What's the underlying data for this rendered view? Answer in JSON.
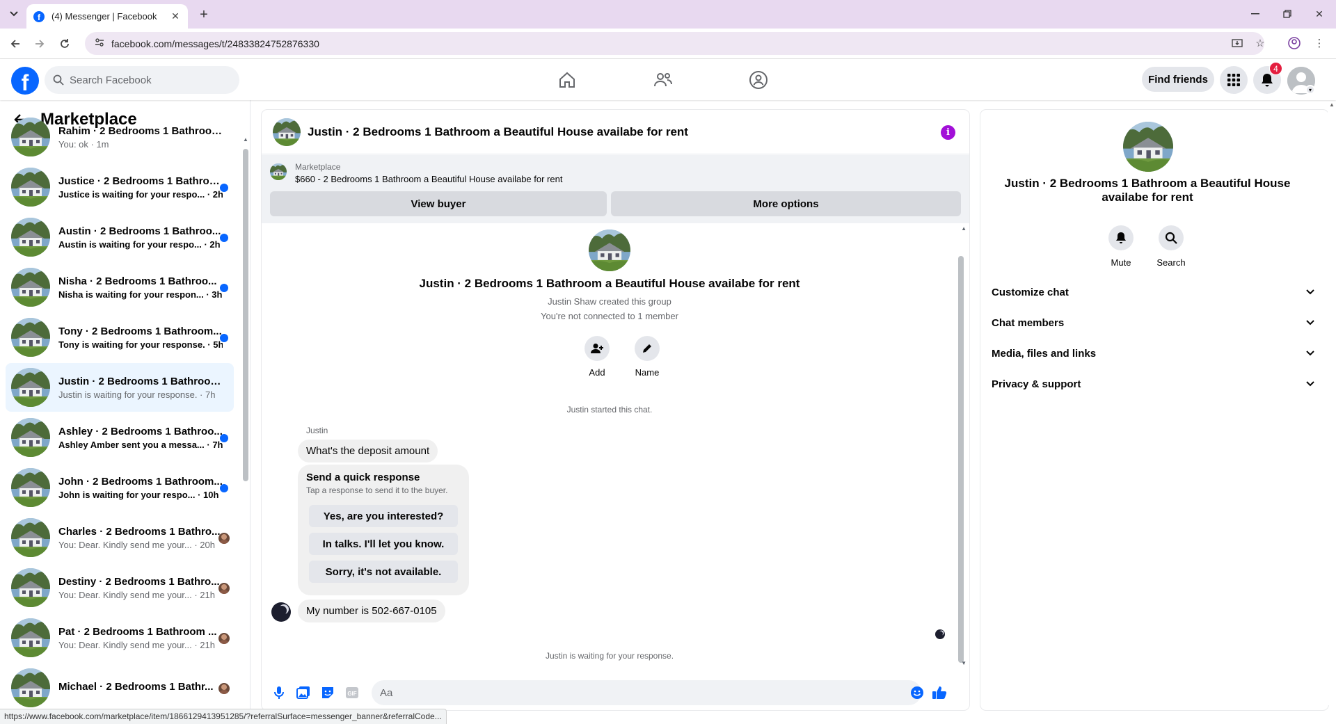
{
  "browser": {
    "tab_title": "(4) Messenger | Facebook",
    "url": "facebook.com/messages/t/24833824752876330",
    "status_url": "https://www.facebook.com/marketplace/item/1866129413951285/?referralSurface=messenger_banner&referralCode..."
  },
  "header": {
    "search_placeholder": "Search Facebook",
    "find_friends": "Find friends",
    "notifications_count": "4"
  },
  "sidebar": {
    "title": "Marketplace",
    "conversations": [
      {
        "name": "Rahim · 2 Bedrooms 1 Bathroom...",
        "snippet": "You: ok · 1m",
        "unread": false,
        "indicator": "none"
      },
      {
        "name": "Justice · 2 Bedrooms 1 Bathroo...",
        "snippet": "Justice is waiting for your respo... · 2h",
        "unread": true,
        "indicator": "dot"
      },
      {
        "name": "Austin · 2 Bedrooms 1 Bathroo...",
        "snippet": "Austin is waiting for your respo... · 2h",
        "unread": true,
        "indicator": "dot"
      },
      {
        "name": "Nisha · 2 Bedrooms 1 Bathroo...",
        "snippet": "Nisha is waiting for your respon... · 3h",
        "unread": true,
        "indicator": "dot"
      },
      {
        "name": "Tony · 2 Bedrooms 1 Bathroom...",
        "snippet": "Tony is waiting for your response. · 5h",
        "unread": true,
        "indicator": "dot"
      },
      {
        "name": "Justin · 2 Bedrooms 1 Bathroom ...",
        "snippet": "Justin is waiting for your response. · 7h",
        "unread": false,
        "indicator": "none",
        "active": true
      },
      {
        "name": "Ashley · 2 Bedrooms 1 Bathroo...",
        "snippet": "Ashley Amber sent you a messa... · 7h",
        "unread": true,
        "indicator": "dot"
      },
      {
        "name": "John · 2 Bedrooms 1 Bathroom...",
        "snippet": "John is waiting for your respo... · 10h",
        "unread": true,
        "indicator": "dot"
      },
      {
        "name": "Charles · 2 Bedrooms 1 Bathro...",
        "snippet": "You: Dear. Kindly send me your... · 20h",
        "unread": false,
        "indicator": "seen"
      },
      {
        "name": "Destiny · 2 Bedrooms 1 Bathro...",
        "snippet": "You: Dear. Kindly send me your... · 21h",
        "unread": false,
        "indicator": "seen"
      },
      {
        "name": "Pat · 2 Bedrooms 1 Bathroom ...",
        "snippet": "You: Dear. Kindly send me your... · 21h",
        "unread": false,
        "indicator": "seen"
      },
      {
        "name": "Michael · 2 Bedrooms 1 Bathr...",
        "snippet": "",
        "unread": false,
        "indicator": "seen"
      }
    ]
  },
  "chat": {
    "title": "Justin · 2 Bedrooms 1 Bathroom a Beautiful House availabe for rent",
    "banner_label": "Marketplace",
    "banner_listing": "$660 - 2 Bedrooms 1 Bathroom a Beautiful House availabe for rent",
    "view_buyer": "View buyer",
    "more_options": "More options",
    "group_title": "Justin · 2 Bedrooms 1 Bathroom a Beautiful House availabe for rent",
    "created_by": "Justin Shaw created this group",
    "not_connected": "You're not connected to 1 member",
    "add_label": "Add",
    "name_label": "Name",
    "started": "Justin started this chat.",
    "sender": "Justin",
    "msg1": "What's the deposit amount",
    "quick_title": "Send a quick response",
    "quick_sub": "Tap a response to send it to the buyer.",
    "quick_replies": [
      "Yes, are you interested?",
      "In talks. I'll let you know.",
      "Sorry, it's not available."
    ],
    "msg2": "My number is 502-667-0105",
    "waiting": "Justin is waiting for your response.",
    "composer_placeholder": "Aa"
  },
  "details": {
    "title": "Justin · 2 Bedrooms 1 Bathroom a Beautiful House availabe for rent",
    "mute": "Mute",
    "search": "Search",
    "sections": [
      "Customize chat",
      "Chat members",
      "Media, files and links",
      "Privacy & support"
    ]
  },
  "colors": {
    "brand": "#0866ff",
    "info_purple": "#a20fd8",
    "badge_red": "#e41e3f",
    "active_row": "#ebf5ff"
  }
}
